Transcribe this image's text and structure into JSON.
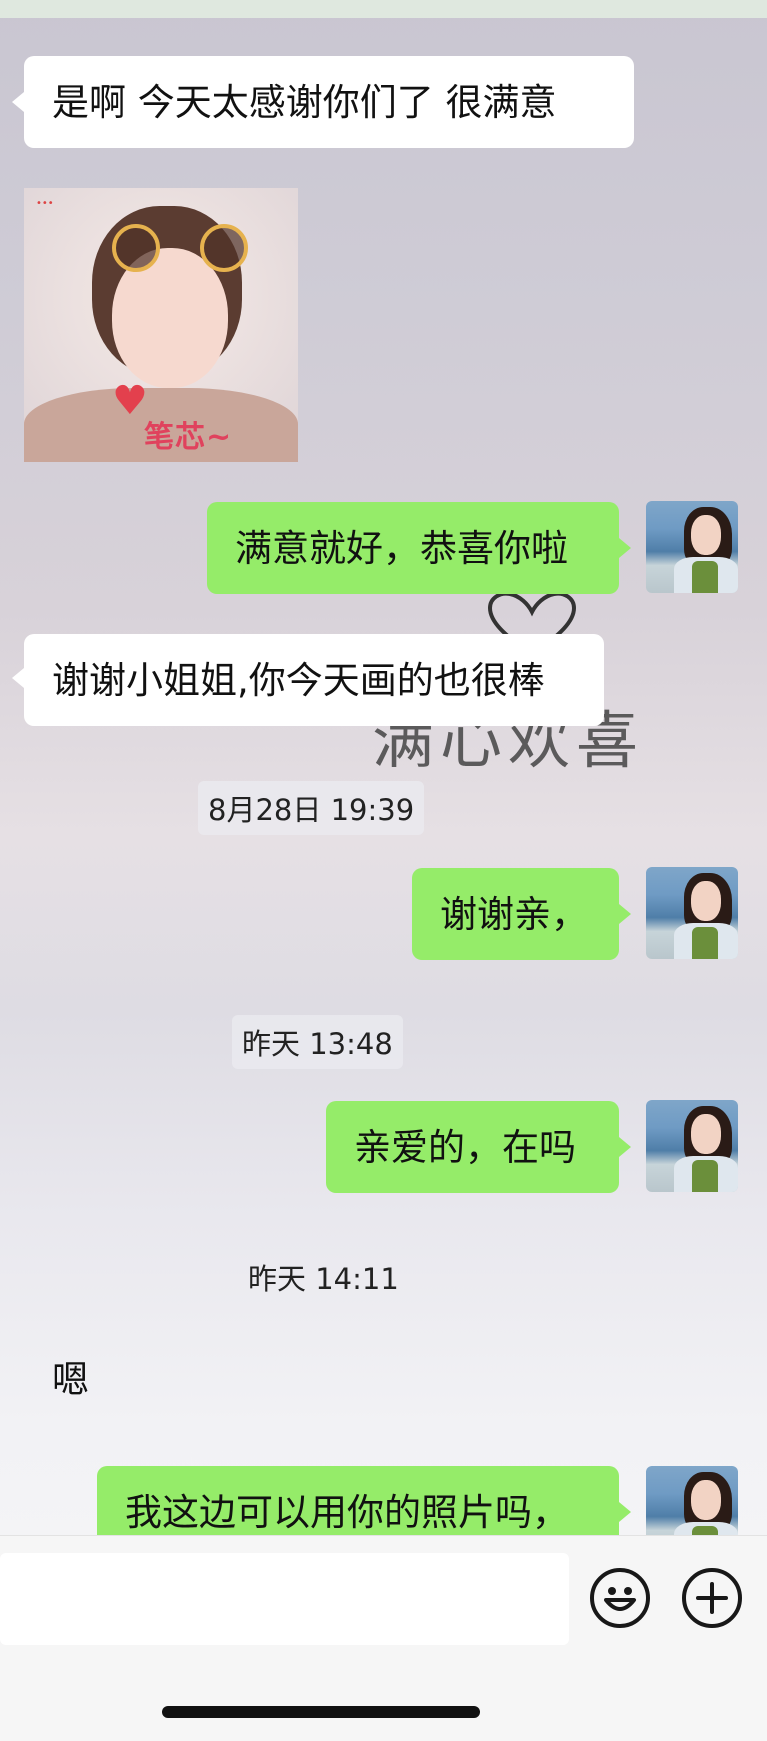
{
  "chat": {
    "messages": [
      {
        "side": "left",
        "text": "是啊  今天太感谢你们了  很满意"
      },
      {
        "side": "left",
        "type": "sticker",
        "caption": "笔芯~"
      },
      {
        "side": "right",
        "text": "满意就好，恭喜你啦"
      },
      {
        "side": "left",
        "text": "谢谢小姐姐,你今天画的也很棒"
      },
      {
        "timestamp": "8月28日 19:39"
      },
      {
        "side": "right",
        "text": "谢谢亲，"
      },
      {
        "timestamp": "昨天 13:48"
      },
      {
        "side": "right",
        "text": "亲爱的，在吗"
      },
      {
        "timestamp": "昨天 14:11"
      },
      {
        "side": "left",
        "text": "嗯"
      },
      {
        "side": "right",
        "text": "我这边可以用你的照片吗，"
      }
    ]
  },
  "background": {
    "decoration_text": "满心欢喜"
  },
  "input_bar": {
    "emoji_icon": "smiley-face-icon",
    "plus_icon": "plus-circle-icon",
    "placeholder": ""
  },
  "colors": {
    "outgoing_bubble": "#95ec69",
    "incoming_bubble": "#ffffff"
  }
}
